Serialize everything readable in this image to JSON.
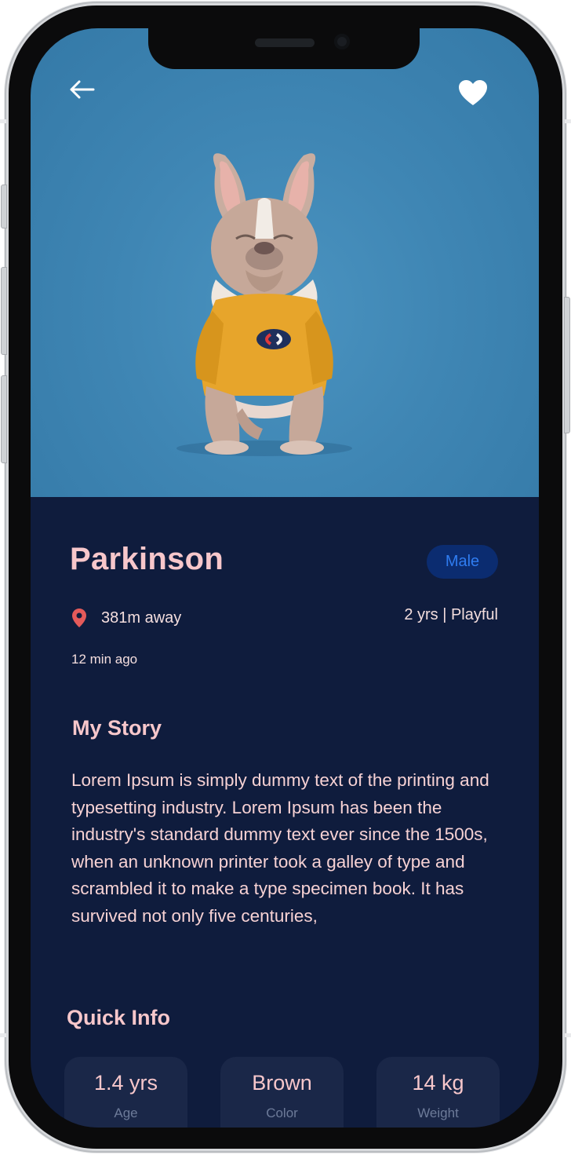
{
  "header": {
    "back_icon": "arrow-left-icon",
    "favorite_icon": "heart-icon"
  },
  "pet": {
    "name": "Parkinson",
    "gender": "Male",
    "distance": "381m away",
    "age_temperament": "2 yrs | Playful",
    "time_ago": "12 min ago"
  },
  "story": {
    "title": "My Story",
    "text": "Lorem Ipsum is simply dummy text of the printing and typesetting industry. Lorem Ipsum has been the industry's standard dummy text ever since the 1500s, when an unknown printer took a galley of type and scrambled it to make a type specimen book. It has survived not only five centuries,"
  },
  "quick_info": {
    "title": "Quick Info",
    "items": [
      {
        "value": "1.4 yrs",
        "label": "Age"
      },
      {
        "value": "Brown",
        "label": "Color"
      },
      {
        "value": "14 kg",
        "label": "Weight"
      }
    ]
  },
  "colors": {
    "background": "#0f1c3d",
    "accent_pink": "#f7c7cb",
    "badge_bg": "#0b2c70",
    "badge_text": "#2f7cf0",
    "pin": "#e45a5a",
    "hero_blue": "#3f86b4"
  }
}
